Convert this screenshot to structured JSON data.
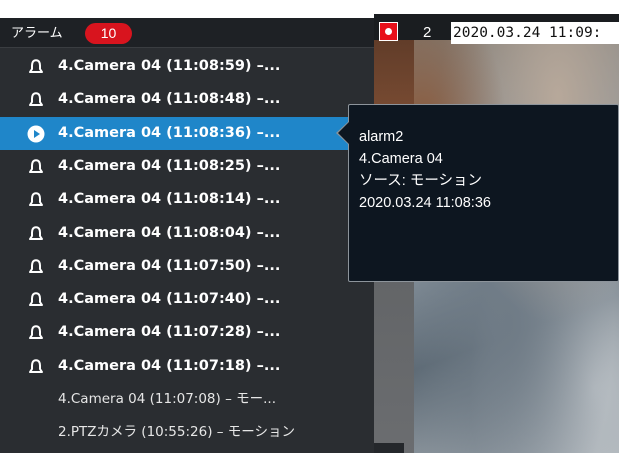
{
  "panel": {
    "title": "アラーム",
    "count": "10"
  },
  "camera_view": {
    "number": "2",
    "timestamp": "2020.03.24 11:09:",
    "rec_color": "#e8101a"
  },
  "alarms": [
    {
      "label": "4.Camera 04 (11:08:59) –...",
      "icon": "bell-icon",
      "state": "unread"
    },
    {
      "label": "4.Camera 04 (11:08:48) –...",
      "icon": "bell-icon",
      "state": "unread"
    },
    {
      "label": "4.Camera 04 (11:08:36) –...",
      "icon": "play-icon",
      "state": "selected"
    },
    {
      "label": "4.Camera 04 (11:08:25) –...",
      "icon": "bell-icon",
      "state": "unread"
    },
    {
      "label": "4.Camera 04 (11:08:14) –...",
      "icon": "bell-icon",
      "state": "unread"
    },
    {
      "label": "4.Camera 04 (11:08:04) –...",
      "icon": "bell-icon",
      "state": "unread"
    },
    {
      "label": "4.Camera 04 (11:07:50) –...",
      "icon": "bell-icon",
      "state": "unread"
    },
    {
      "label": "4.Camera 04 (11:07:40) –...",
      "icon": "bell-icon",
      "state": "unread"
    },
    {
      "label": "4.Camera 04 (11:07:28) –...",
      "icon": "bell-icon",
      "state": "unread"
    },
    {
      "label": "4.Camera 04 (11:07:18) –...",
      "icon": "bell-icon",
      "state": "unread"
    },
    {
      "label": "4.Camera 04 (11:07:08) – モー...",
      "icon": "",
      "state": "read"
    },
    {
      "label": "2.PTZカメラ (10:55:26) – モーション",
      "icon": "",
      "state": "read"
    }
  ],
  "tooltip": {
    "name": "alarm2",
    "camera": "4.Camera 04",
    "source": "ソース: モーション",
    "datetime": "2020.03.24 11:08:36"
  },
  "colors": {
    "selected_row": "#1f86c9",
    "badge": "#d8141e",
    "panel_bg": "#2a2d31"
  }
}
